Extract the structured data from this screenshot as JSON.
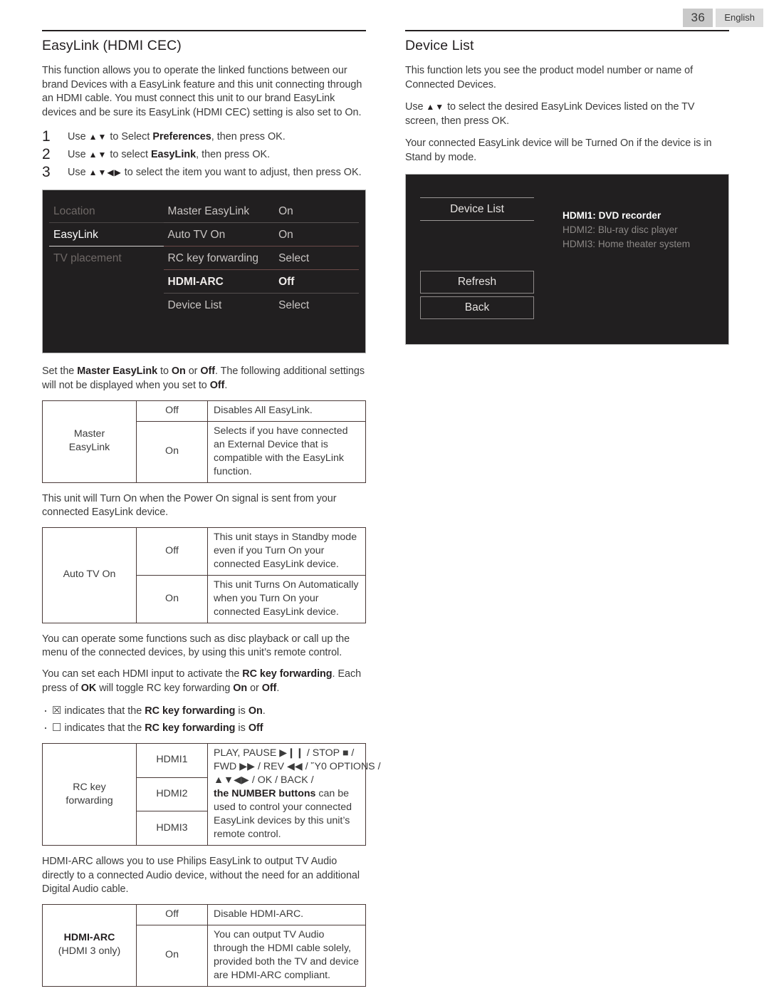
{
  "header": {
    "page_number": "36",
    "language": "English"
  },
  "left": {
    "title": "EasyLink (HDMI CEC)",
    "intro": "This function allows you to operate the linked functions between our brand Devices with a EasyLink feature and this unit connecting through an HDMI cable. You must connect this unit to our brand EasyLink devices and be sure its EasyLink (HDMI CEC) setting is also set to On.",
    "steps": [
      {
        "num": "1",
        "pre": "Use ",
        "arrows": "▲▼",
        "mid": " to Select ",
        "bold": "Preferences",
        "post": ", then press OK."
      },
      {
        "num": "2",
        "pre": "Use ",
        "arrows": "▲▼",
        "mid": " to select ",
        "bold": "EasyLink",
        "post": ", then press OK."
      },
      {
        "num": "3",
        "pre": "Use ",
        "arrows": "▲▼◀▶",
        "mid": " to select the item you want to adjust, then press OK.",
        "bold": "",
        "post": ""
      }
    ],
    "tv_menu": {
      "col1": [
        "Location",
        "EasyLink",
        "TV placement"
      ],
      "col2": [
        "Master EasyLink",
        "Auto TV On",
        "RC key forwarding",
        "HDMI-ARC",
        "Device List"
      ],
      "col3": [
        "On",
        "On",
        "Select",
        "Off",
        "Select"
      ]
    },
    "master_intro_a": "Set the ",
    "master_intro_b": "Master EasyLink",
    "master_intro_c": " to ",
    "master_intro_d": "On",
    "master_intro_e": " or ",
    "master_intro_f": "Off",
    "master_intro_g": ". The following additional settings will not be displayed when you set to ",
    "master_intro_h": "Off",
    "master_intro_i": ".",
    "master_table": {
      "label_line1": "Master",
      "label_line2": "EasyLink",
      "rows": [
        {
          "value": "Off",
          "desc": "Disables All EasyLink."
        },
        {
          "value": "On",
          "desc": "Selects if you have connected an External Device that is compatible with the EasyLink function."
        }
      ]
    },
    "auto_intro": "This unit will Turn On when the Power On signal is sent from your connected EasyLink device.",
    "auto_table": {
      "label": "Auto TV On",
      "rows": [
        {
          "value": "Off",
          "desc": "This unit stays in Standby mode even if you Turn On your connected EasyLink device."
        },
        {
          "value": "On",
          "desc": "This unit Turns On Automatically when you Turn On your connected EasyLink device."
        }
      ]
    },
    "rc_para_1": "You can operate some functions such as disc playback or call up the menu of the connected devices, by using this unit’s remote control.",
    "rc_para_2_a": "You can set each HDMI input to activate the ",
    "rc_para_2_b": "RC key forwarding",
    "rc_para_2_c": ". Each press of ",
    "rc_para_2_d": "OK",
    "rc_para_2_e": " will toggle RC key forwarding ",
    "rc_para_2_f": "On",
    "rc_para_2_g": " or ",
    "rc_para_2_h": "Off",
    "rc_para_2_i": ".",
    "bullets": [
      {
        "glyph": "☒",
        "pre": " indicates that the ",
        "bold": "RC key forwarding",
        "post": " is ",
        "state": "On",
        "tail": "."
      },
      {
        "glyph": "☐",
        "pre": " indicates that the ",
        "bold": "RC key forwarding",
        "post": " is ",
        "state": "Off",
        "tail": ""
      }
    ],
    "rc_table": {
      "label_line1": "RC key",
      "label_line2": "forwarding",
      "inputs": [
        "HDMI1",
        "HDMI2",
        "HDMI3"
      ],
      "desc_line1": "PLAY, PAUSE ▶❙❙ / STOP ■ /",
      "desc_line2": "FWD ▶▶ / REV ◀◀ / Ὕ0 OPTIONS /",
      "desc_line3": "▲▼◀▶ / OK / BACK /",
      "desc_line4_bold": "the NUMBER buttons",
      "desc_line4_rest": " can be used to control your connected EasyLink devices by this unit’s remote control."
    },
    "arc_intro": "HDMI-ARC allows you to use Philips EasyLink to output TV Audio directly to a connected Audio device, without the need for an additional Digital Audio cable.",
    "arc_table": {
      "label_line1": "HDMI-ARC",
      "label_line2": "(HDMI 3 only)",
      "rows": [
        {
          "value": "Off",
          "desc": "Disable HDMI-ARC."
        },
        {
          "value": "On",
          "desc": "You can output TV Audio through the HDMI cable solely, provided both the TV and device are HDMI-ARC compliant."
        }
      ]
    }
  },
  "right": {
    "title": "Device List",
    "para_1": "This function lets you see the product model number or name of Connected Devices.",
    "para_2_pre": "Use ",
    "para_2_arrows": "▲▼",
    "para_2_post": " to select the desired EasyLink Devices listed on the TV screen, then press OK.",
    "para_3": "Your connected EasyLink device will be Turned On if the device is in Stand by mode.",
    "device_panel": {
      "title": "Device List",
      "buttons": [
        "Refresh",
        "Back"
      ],
      "devices": [
        {
          "label": "HDMI1: DVD recorder",
          "selected": true
        },
        {
          "label": "HDMI2: Blu-ray disc player",
          "selected": false
        },
        {
          "label": "HDMI3: Home theater system",
          "selected": false
        }
      ]
    }
  }
}
